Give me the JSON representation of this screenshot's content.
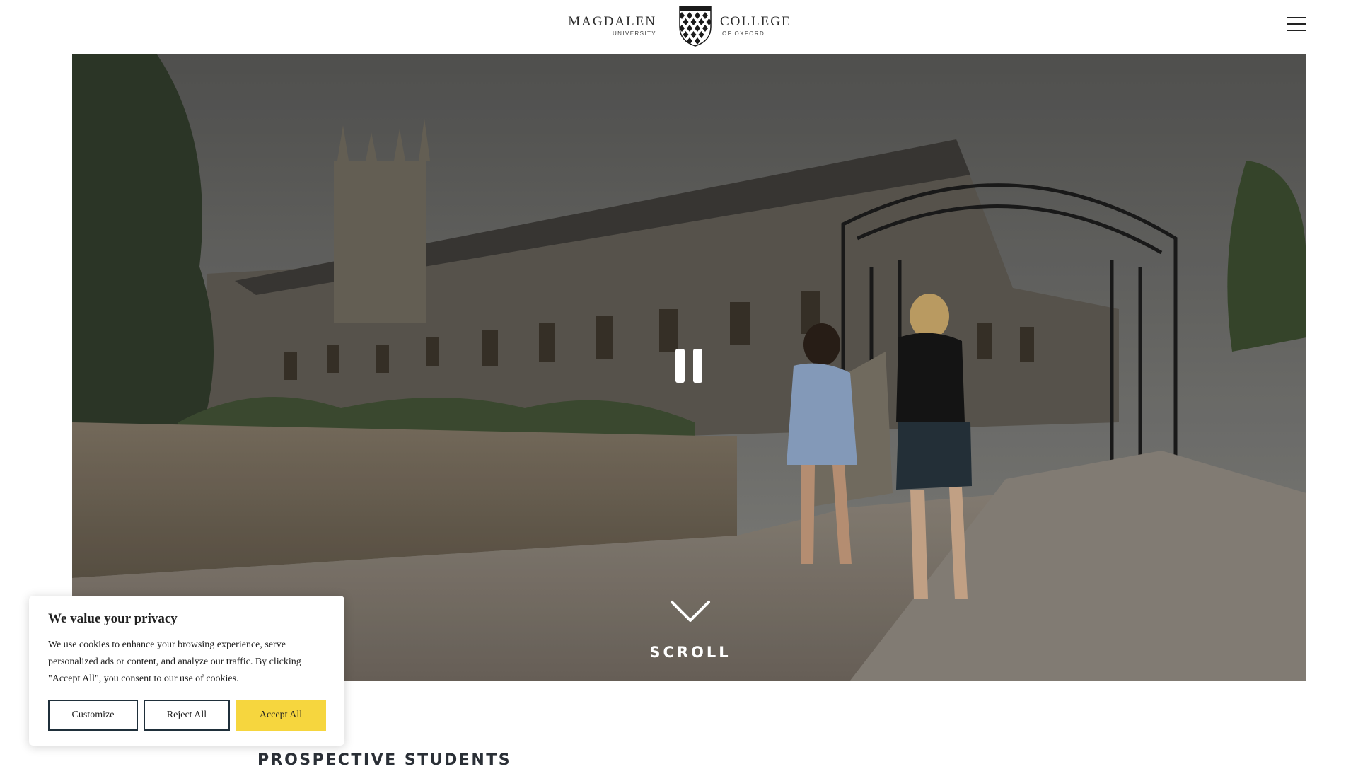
{
  "header": {
    "logo_left": "MAGDALEN",
    "logo_left_sub": "UNIVERSITY",
    "logo_right": "COLLEGE",
    "logo_right_sub": "OF OXFORD",
    "menu_icon": "hamburger-menu-icon"
  },
  "hero": {
    "pause_icon": "pause-icon",
    "scroll_icon": "chevron-down-icon",
    "scroll_label": "SCROLL"
  },
  "cookie_banner": {
    "title": "We value your privacy",
    "body": "We use cookies to enhance your browsing experience, serve personalized ads or content, and analyze our traffic. By clicking \"Accept All\", you consent to our use of cookies.",
    "customize_label": "Customize",
    "reject_label": "Reject All",
    "accept_label": "Accept All",
    "accept_color": "#f6d63e"
  },
  "section": {
    "title": "PROSPECTIVE STUDENTS"
  }
}
